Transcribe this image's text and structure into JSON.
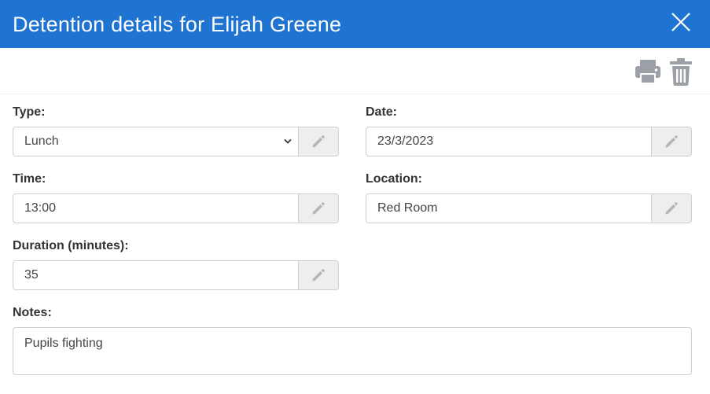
{
  "dialog": {
    "title": "Detention details for Elijah Greene",
    "colors": {
      "header": "#1f74d1",
      "icon": "#9aa0a6"
    },
    "icons": {
      "close": "close-icon",
      "print": "printer-icon",
      "delete": "trash-icon",
      "edit": "pencil-icon",
      "dropdown": "chevron-down-icon"
    }
  },
  "form": {
    "type": {
      "label": "Type:",
      "value": "Lunch"
    },
    "date": {
      "label": "Date:",
      "value": "23/3/2023"
    },
    "time": {
      "label": "Time:",
      "value": "13:00"
    },
    "location": {
      "label": "Location:",
      "value": "Red Room"
    },
    "duration": {
      "label": "Duration (minutes):",
      "value": "35"
    },
    "notes": {
      "label": "Notes:",
      "value": "Pupils fighting"
    }
  }
}
